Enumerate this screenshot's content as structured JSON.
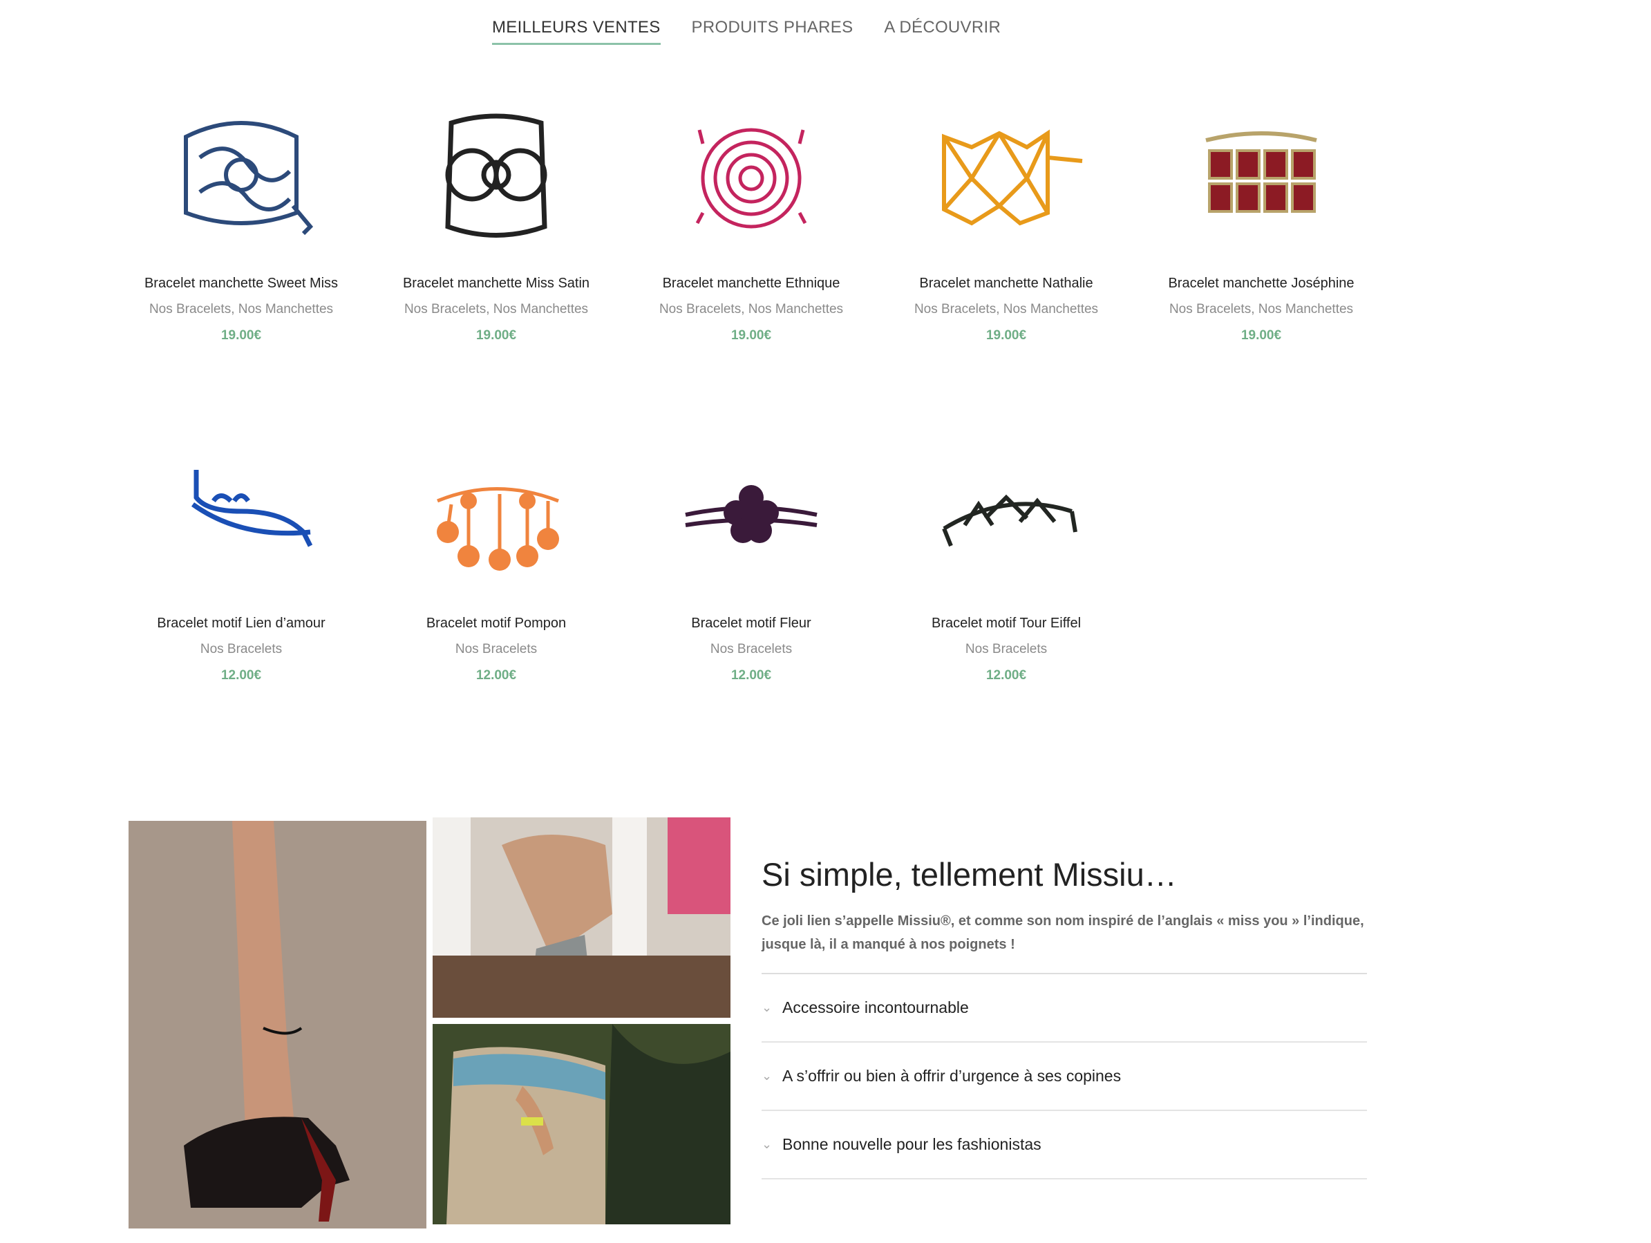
{
  "tabs": [
    {
      "label": "MEILLEURS VENTES",
      "active": true
    },
    {
      "label": "PRODUITS PHARES",
      "active": false
    },
    {
      "label": "A DÉCOUVRIR",
      "active": false
    }
  ],
  "products": [
    {
      "name": "Bracelet manchette Sweet Miss",
      "category": "Nos Bracelets, Nos Manchettes",
      "price": "19.00€",
      "color": "#2c4a7a"
    },
    {
      "name": "Bracelet manchette Miss Satin",
      "category": "Nos Bracelets, Nos Manchettes",
      "price": "19.00€",
      "color": "#222222"
    },
    {
      "name": "Bracelet manchette Ethnique",
      "category": "Nos Bracelets, Nos Manchettes",
      "price": "19.00€",
      "color": "#c4245e"
    },
    {
      "name": "Bracelet manchette Nathalie",
      "category": "Nos Bracelets, Nos Manchettes",
      "price": "19.00€",
      "color": "#e89a1a"
    },
    {
      "name": "Bracelet manchette Joséphine",
      "category": "Nos Bracelets, Nos Manchettes",
      "price": "19.00€",
      "color": "#8c1b24"
    },
    {
      "name": "Bracelet motif Lien d’amour",
      "category": "Nos Bracelets",
      "price": "12.00€",
      "color": "#1a4fb5"
    },
    {
      "name": "Bracelet motif Pompon",
      "category": "Nos Bracelets",
      "price": "12.00€",
      "color": "#f0843e"
    },
    {
      "name": "Bracelet motif Fleur",
      "category": "Nos Bracelets",
      "price": "12.00€",
      "color": "#3a1a3a"
    },
    {
      "name": "Bracelet motif Tour Eiffel",
      "category": "Nos Bracelets",
      "price": "12.00€",
      "color": "#222622"
    }
  ],
  "feature": {
    "title": "Si simple, tellement Missiu…",
    "lead": "Ce joli lien s’appelle Missiu®, et comme son nom inspiré de l’anglais « miss you » l’indique, jusque là, il a manqué à nos poignets !",
    "accordion": [
      "Accessoire incontournable",
      "A s’offrir ou bien à offrir d’urgence à ses copines",
      "Bonne nouvelle pour les fashionistas"
    ]
  }
}
